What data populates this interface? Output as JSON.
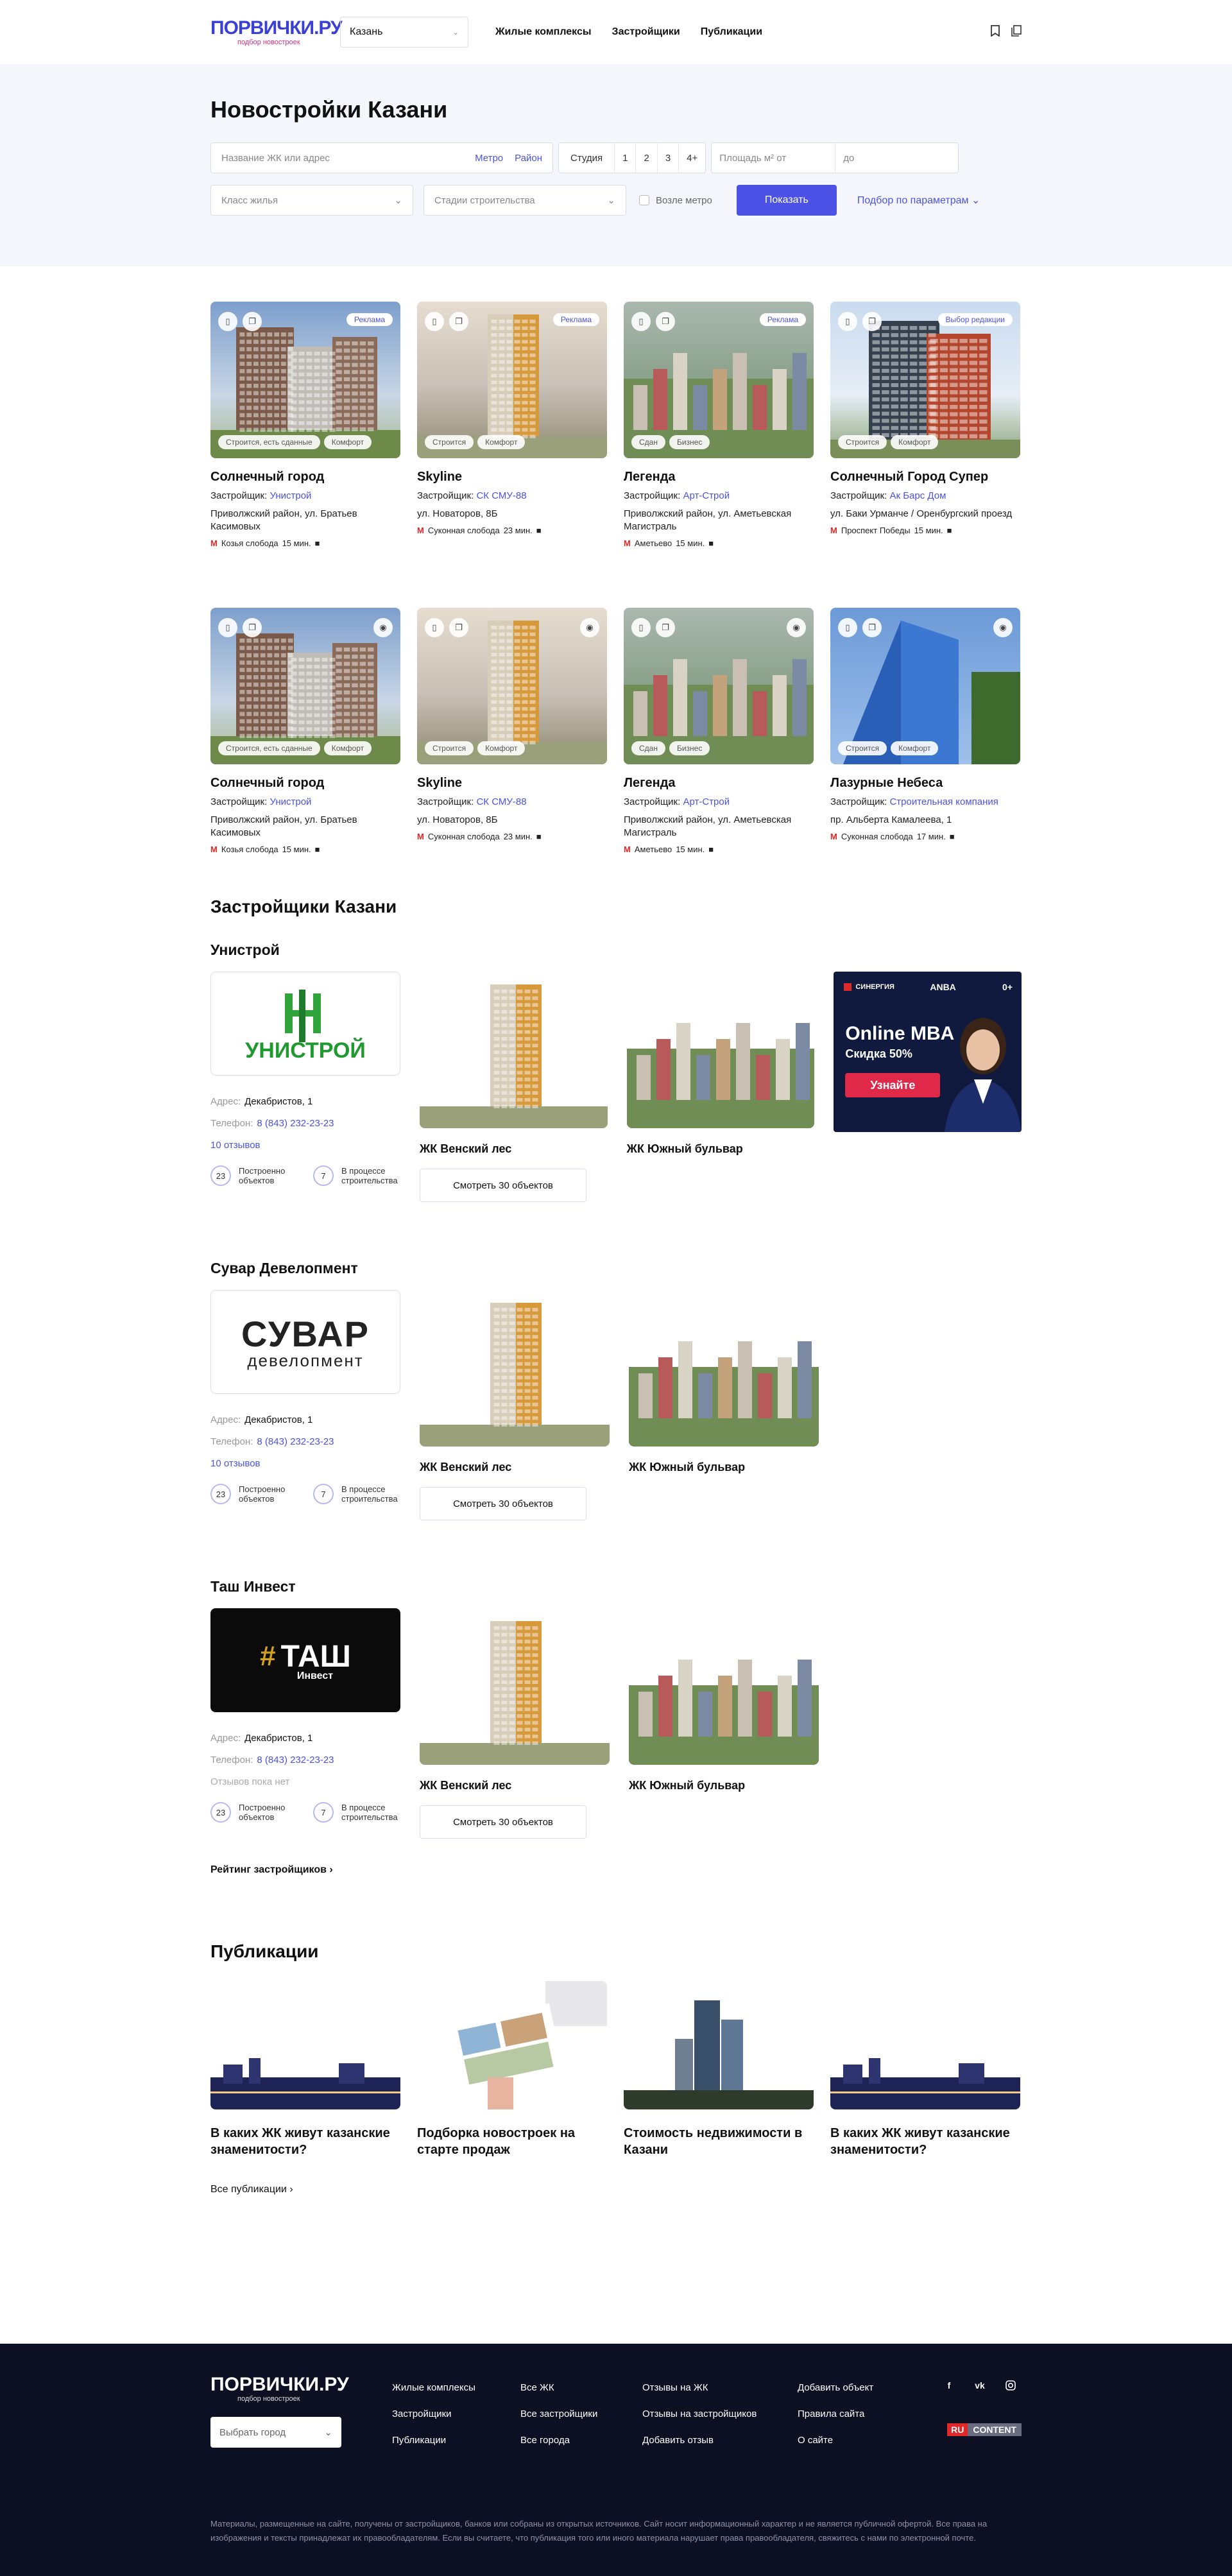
{
  "header": {
    "logo_text_a": "П",
    "logo_text_b": "ОРВИЧКИ.РУ",
    "logo_sub": "подбор новостроек",
    "city": "Казань",
    "nav": [
      "Жилые комплексы",
      "Застройщики",
      "Публикации"
    ]
  },
  "search": {
    "title": "Новостройки Казани",
    "name_placeholder": "Название ЖК или адрес",
    "metro_link": "Метро",
    "district_link": "Район",
    "rooms": [
      "Студия",
      "1",
      "2",
      "3",
      "4+"
    ],
    "area_from": "Площадь м² от",
    "area_to": "до",
    "class_placeholder": "Класс жилья",
    "stage_placeholder": "Стадии строительства",
    "near_metro": "Возле метро",
    "show_button": "Показать",
    "more_params": "Подбор по параметрам"
  },
  "complexes": [
    {
      "name": "Солнечный город",
      "dev_label": "Застройщик:",
      "dev": "Унистрой",
      "address": "Приволжский район, ул. Братьев Касимовых",
      "metro": "Козья слобода",
      "time": "15 мин.",
      "badge": "Реклама",
      "tags": [
        "Строится, есть сданные",
        "Комфорт"
      ]
    },
    {
      "name": "Skyline",
      "dev_label": "Застройщик:",
      "dev": "СК СМУ-88",
      "address": "ул. Новаторов, 8Б",
      "metro": "Суконная слобода",
      "time": "23 мин.",
      "badge": "Реклама",
      "tags": [
        "Строится",
        "Комфорт"
      ]
    },
    {
      "name": "Легенда",
      "dev_label": "Застройщик:",
      "dev": "Арт-Строй",
      "address": "Приволжский район, ул. Аметьевская Магистраль",
      "metro": "Аметьево",
      "time": "15 мин.",
      "badge": "Реклама",
      "tags": [
        "Сдан",
        "Бизнес"
      ]
    },
    {
      "name": "Солнечный Город Супер",
      "dev_label": "Застройщик:",
      "dev": "Ак Барс Дом",
      "address": "ул. Баки Урманче / Оренбургский проезд",
      "metro": "Проспект Победы",
      "time": "15 мин.",
      "badge": "Выбор редакции",
      "tags": [
        "Строится",
        "Комфорт"
      ]
    },
    {
      "name": "Солнечный город",
      "dev_label": "Застройщик:",
      "dev": "Унистрой",
      "address": "Приволжский район, ул. Братьев Касимовых",
      "metro": "Козья слобода",
      "time": "15 мин.",
      "badge": "",
      "tags": [
        "Строится, есть сданные",
        "Комфорт"
      ]
    },
    {
      "name": "Skyline",
      "dev_label": "Застройщик:",
      "dev": "СК СМУ-88",
      "address": "ул. Новаторов, 8Б",
      "metro": "Суконная слобода",
      "time": "23 мин.",
      "badge": "",
      "tags": [
        "Строится",
        "Комфорт"
      ]
    },
    {
      "name": "Легенда",
      "dev_label": "Застройщик:",
      "dev": "Арт-Строй",
      "address": "Приволжский район, ул. Аметьевская Магистраль",
      "metro": "Аметьево",
      "time": "15 мин.",
      "badge": "",
      "tags": [
        "Сдан",
        "Бизнес"
      ]
    },
    {
      "name": "Лазурные Небеса",
      "dev_label": "Застройщик:",
      "dev": "Строительная компания",
      "address": "пр. Альберта Камалеева, 1",
      "metro": "Суконная слобода",
      "time": "17 мин.",
      "badge": "",
      "tags": [
        "Строится",
        "Комфорт"
      ]
    }
  ],
  "developers": {
    "title": "Застройщики Казани",
    "address_label": "Адрес:",
    "phone_label": "Телефон:",
    "stat1_label": "Построенно объектов",
    "stat2_label": "В процессе строительства",
    "items": [
      {
        "name": "Унистрой",
        "logo": "УНИСТРОЙ",
        "address": "Декабристов, 1",
        "phone": "8 (843) 232-23-23",
        "reviews": "10 отзывов",
        "built": "23",
        "building": "7"
      },
      {
        "name": "Сувар Девелопмент",
        "logo": "СУВАР",
        "logo_sub": "девелопмент",
        "address": "Декабристов, 1",
        "phone": "8 (843) 232-23-23",
        "reviews": "10 отзывов",
        "built": "23",
        "building": "7"
      },
      {
        "name": "Таш Инвест",
        "logo": "ТАШ",
        "logo_sub": "Инвест",
        "address": "Декабристов, 1",
        "phone": "8 (843) 232-23-23",
        "reviews": "Отзывов пока нет",
        "built": "23",
        "building": "7"
      }
    ],
    "project1": "ЖК Венский лес",
    "project2": "ЖК Южный бульвар",
    "show_objects": "Смотреть 30 объектов",
    "rating_link": "Рейтинг застройщиков"
  },
  "banner": {
    "brand": "СИНЕРГИЯ",
    "brand2": "ANBA",
    "age": "0+",
    "title": "Online MBA",
    "discount": "Скидка 50%",
    "cta": "Узнайте"
  },
  "publications": {
    "title": "Публикации",
    "items": [
      "В каких ЖК живут казанские знаменитости?",
      "Подборка новостроек на старте продаж",
      "Стоимость недвижимости в Казани",
      "В каких ЖК живут казанские знаменитости?"
    ],
    "all": "Все публикации"
  },
  "footer": {
    "logo": "ПОРВИЧКИ.РУ",
    "logo_sub": "подбор новостроек",
    "city_placeholder": "Выбрать город",
    "col1": [
      "Жилые комплексы",
      "Застройщики",
      "Публикации"
    ],
    "col2": [
      "Все ЖК",
      "Все застройщики",
      "Все города"
    ],
    "col3": [
      "Отзывы на ЖК",
      "Отзывы на застройщиков",
      "Добавить отзыв"
    ],
    "col4": [
      "Добавить объект",
      "Правила сайта",
      "О сайте"
    ],
    "social": [
      "f",
      "vk",
      "ig"
    ],
    "ru": "RU",
    "content": "CONTENT",
    "note": "Материалы, размещенные на сайте, получены от застройщиков, банков или собраны из открытых источников. Сайт носит информационный характер и не является публичной офертой. Все права на изображения и тексты принадлежат их правообладателям. Если вы считаете, что публикация того или иного материала нарушает права правообладателя, свяжитесь с нами по электронной почте."
  },
  "colors": {
    "accent": "#4b52e5",
    "brand_pink": "#e0287a",
    "band": "#f5f6fc",
    "footer": "#0d0f22"
  }
}
